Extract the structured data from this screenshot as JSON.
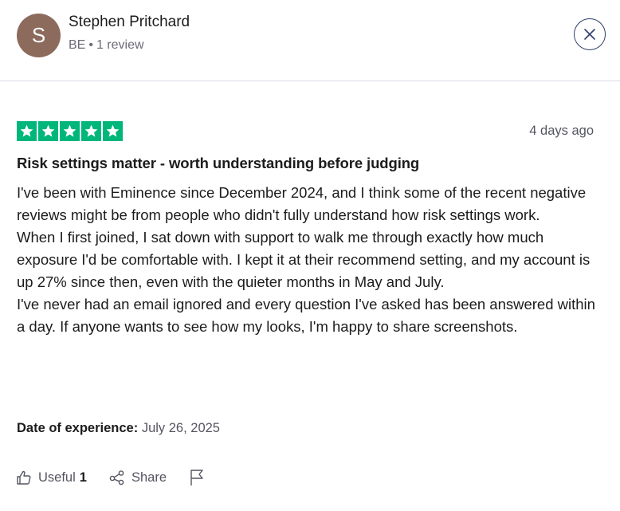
{
  "reviewer": {
    "initial": "S",
    "name": "Stephen Pritchard",
    "country": "BE",
    "separator": "•",
    "review_count": "1 review",
    "avatar_color": "#8c6b5d"
  },
  "review": {
    "rating": 5,
    "star_color": "#00b67a",
    "time_ago": "4 days ago",
    "title": "Risk settings matter - worth understanding before judging",
    "paragraphs": [
      "I've been with Eminence since December 2024, and I think some of the recent negative reviews might be from people who didn't fully understand how risk settings work.",
      "When I first joined, I sat down with support to walk me through exactly how much exposure I'd be comfortable with. I kept it at their recommend setting, and my account is up 27% since then, even with the quieter months in May and July.",
      "I've never had an email ignored and every question I've asked has been answered within a day. If anyone wants to see how my looks, I'm happy to share screenshots."
    ],
    "experience_label": "Date of experience:",
    "experience_date": "July 26, 2025"
  },
  "actions": {
    "useful_label": "Useful",
    "useful_count": "1",
    "share_label": "Share"
  },
  "icons": [
    "close-icon",
    "star-icon",
    "thumbs-up-icon",
    "share-icon",
    "flag-icon"
  ]
}
